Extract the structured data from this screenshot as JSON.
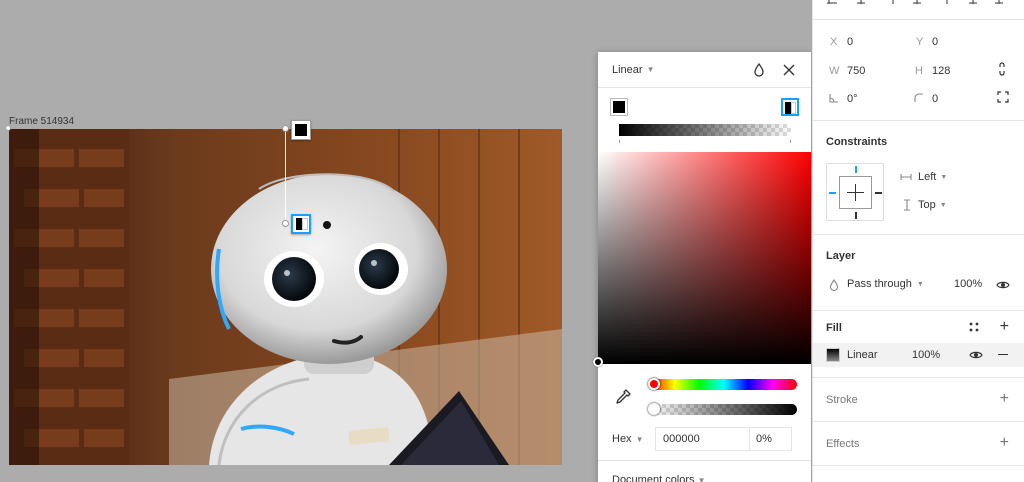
{
  "canvas": {
    "frame_label": "Frame 514934"
  },
  "color_picker": {
    "fill_type": "Linear",
    "color_mode": "Hex",
    "hex_value": "000000",
    "alpha_value": "0%",
    "section_label": "Document colors",
    "selected_color": "#ff0000"
  },
  "properties": {
    "x_label": "X",
    "x_value": "0",
    "y_label": "Y",
    "y_value": "0",
    "w_label": "W",
    "w_value": "750",
    "h_label": "H",
    "h_value": "128",
    "rotation_value": "0°",
    "radius_value": "0",
    "constraints_title": "Constraints",
    "constraint_horizontal": "Left",
    "constraint_vertical": "Top",
    "layer_title": "Layer",
    "blend_mode": "Pass through",
    "layer_opacity": "100%",
    "fill_title": "Fill",
    "fill_type": "Linear",
    "fill_opacity": "100%",
    "stroke_title": "Stroke",
    "effects_title": "Effects"
  },
  "colors": {
    "accent": "#18a0fb",
    "panel_bg": "#ffffff",
    "canvas_bg": "#acacac"
  }
}
